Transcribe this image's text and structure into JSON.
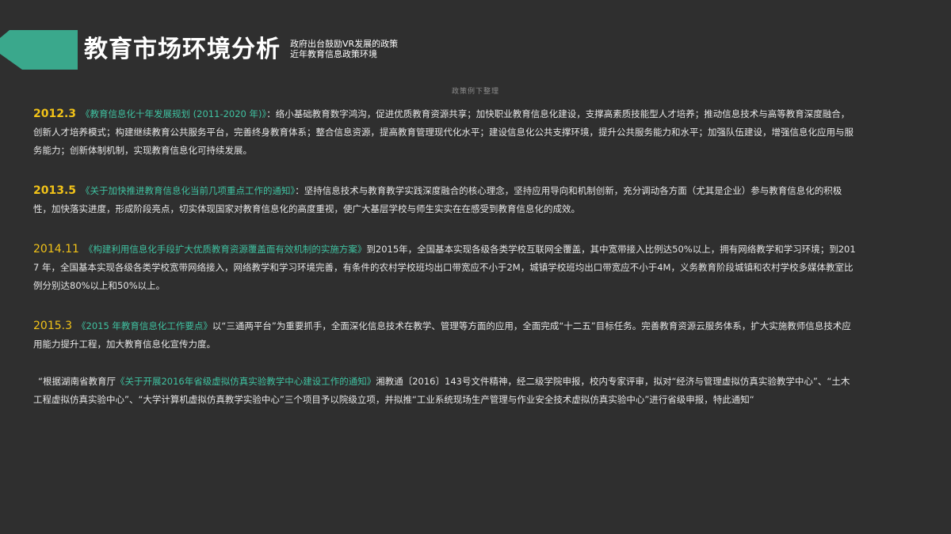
{
  "header": {
    "title": "教育市场环境分析",
    "subtitle_line1": "政府出台鼓励VR发展的政策",
    "subtitle_line2": "近年教育信息政策环境",
    "accent_color": "#3aa88c"
  },
  "top_note": "政策例下整理",
  "entries": [
    {
      "year": "2012.3",
      "policy": "《教育信息化十年发展规划 (2011-2020 年)》",
      "text": "：络小基础教育数字鸿沟，促进优质教育资源共享；加快职业教育信息化建设，支撑高素质技能型人才培养；推动信息技术与高等教育深度融合，创新人才培养模式；构建继续教育公共服务平台，完善终身教育体系；整合信息资源，提高教育管理现代化水平；建设信息化公共支撑环境，提升公共服务能力和水平；加强队伍建设，增强信息化应用与服务能力；创新体制机制，实现教育信息化可持续发展。"
    },
    {
      "year": "2013.5",
      "policy": "《关于加快推进教育信息化当前几项重点工作的通知》",
      "text": "：坚持信息技术与教育教学实践深度融合的核心理念，坚持应用导向和机制创新，充分调动各方面（尤其是企业）参与教育信息化的积极性，加快落实进度，形成阶段亮点，切实体现国家对教育信息化的高度重视，使广大基层学校与师生实实在在感受到教育信息化的成效。"
    },
    {
      "year": "2014.11",
      "policy": "《构建利用信息化手段扩大优质教育资源覆盖面有效机制的实施方案》",
      "text": "到2015年，全国基本实现各级各类学校互联网全覆盖，其中宽带接入比例达50%以上，拥有网络教学和学习环境；到2017 年，全国基本实现各级各类学校宽带网络接入，网络教学和学习环境完善，有条件的农村学校班均出口带宽应不小于2M，城镇学校班均出口带宽应不小于4M，义务教育阶段城镇和农村学校多媒体教室比例分别达80%以上和50%以上。"
    },
    {
      "year": "2015.3",
      "policy": "《2015 年教育信息化工作要点》",
      "text": "以“三通两平台”为重要抓手，全面深化信息技术在教学、管理等方面的应用，全面完成“十二五”目标任务。完善教育资源云服务体系，扩大实施教师信息技术应用能力提升工程，加大教育信息化宣传力度。"
    }
  ],
  "notice": {
    "prefix": "“根据湖南省教育厅",
    "policy": "《关于开展2016年省级虚拟仿真实验教学中心建设工作的通知》",
    "text": "湘教通〔2016〕143号文件精神，经二级学院申报，校内专家评审，拟对“经济与管理虚拟仿真实验教学中心”、“土木工程虚拟仿真实验中心”、“大学计算机虚拟仿真教学实验中心”三个项目予以院级立项，并拟推“工业系统现场生产管理与作业安全技术虚拟仿真实验中心”进行省级申报，特此通知“"
  }
}
